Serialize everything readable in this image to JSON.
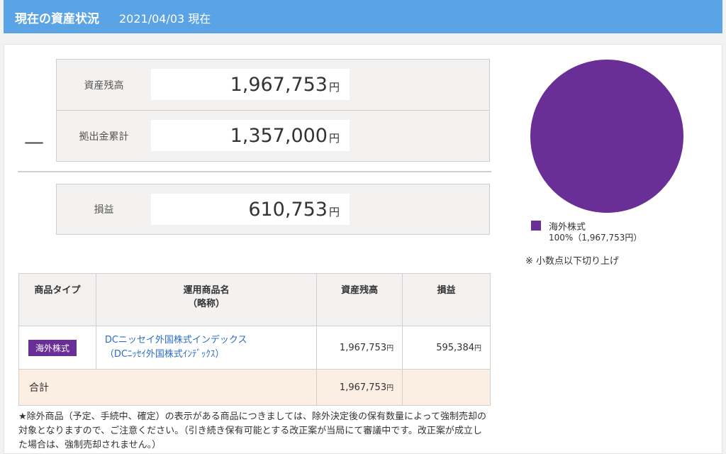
{
  "header": {
    "title": "現在の資産状況",
    "date": "2021/04/03 現在"
  },
  "summary": {
    "minus_sign": "—",
    "assets_balance": {
      "label": "資産残高",
      "value": "1,967,753",
      "unit": "円"
    },
    "contributions": {
      "label": "拠出金累計",
      "value": "1,357,000",
      "unit": "円"
    },
    "profit_loss": {
      "label": "損益",
      "value": "610,753",
      "unit": "円"
    }
  },
  "chart_data": {
    "type": "pie",
    "slices": [
      {
        "label": "海外株式",
        "percent": 100,
        "amount": "1,967,753円",
        "color": "#6a2f96"
      }
    ],
    "legend_value_text": "100%（1,967,753円）",
    "note": "※ 小数点以下切り上げ"
  },
  "table": {
    "headers": {
      "type": "商品タイプ",
      "name_line1": "運用商品名",
      "name_line2": "（略称）",
      "balance": "資産残高",
      "pl": "損益"
    },
    "rows": [
      {
        "type": "海外株式",
        "name": "DCニッセイ外国株式インデックス",
        "short_name": "（DCﾆｯｾｲ外国株式ｲﾝﾃﾞｯｸｽ）",
        "balance": "1,967,753",
        "pl": "595,384",
        "unit": "円"
      }
    ],
    "total": {
      "label": "合計",
      "balance": "1,967,753",
      "unit": "円"
    }
  },
  "footnote": "★除外商品（予定、手続中、確定）の表示がある商品につきましては、除外決定後の保有数量によって強制売却の対象となりますので、ご注意ください。（引き続き保有可能とする改正案が当局にて審議中です。改正案が成立した場合は、強制売却されません。）"
}
